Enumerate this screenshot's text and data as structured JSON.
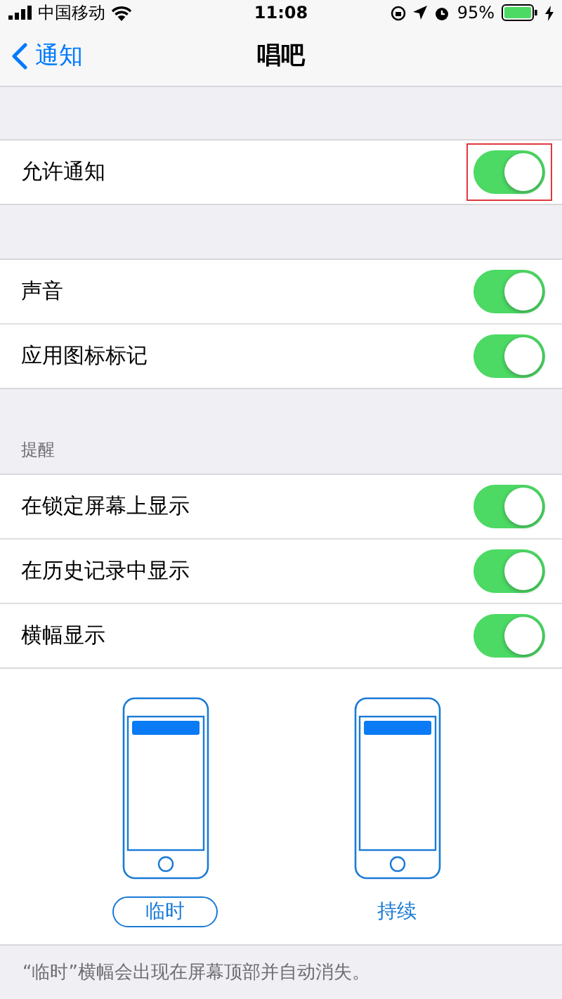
{
  "status_bar": {
    "carrier": "中国移动",
    "time": "11:08",
    "battery": "95%"
  },
  "nav": {
    "back": "通知",
    "title": "唱吧"
  },
  "groups": [
    {
      "rows": [
        {
          "label": "允许通知",
          "on": true,
          "highlighted": true
        }
      ]
    },
    {
      "rows": [
        {
          "label": "声音",
          "on": true,
          "highlighted": false
        },
        {
          "label": "应用图标标记",
          "on": true,
          "highlighted": false
        }
      ]
    },
    {
      "header": "提醒",
      "rows": [
        {
          "label": "在锁定屏幕上显示",
          "on": true,
          "highlighted": false
        },
        {
          "label": "在历史记录中显示",
          "on": true,
          "highlighted": false
        },
        {
          "label": "横幅显示",
          "on": true,
          "highlighted": false
        }
      ]
    }
  ],
  "banner_styles": [
    {
      "label": "临时",
      "selected": true
    },
    {
      "label": "持续",
      "selected": false
    }
  ],
  "footer": "“临时”横幅会出现在屏幕顶部并自动消失。"
}
